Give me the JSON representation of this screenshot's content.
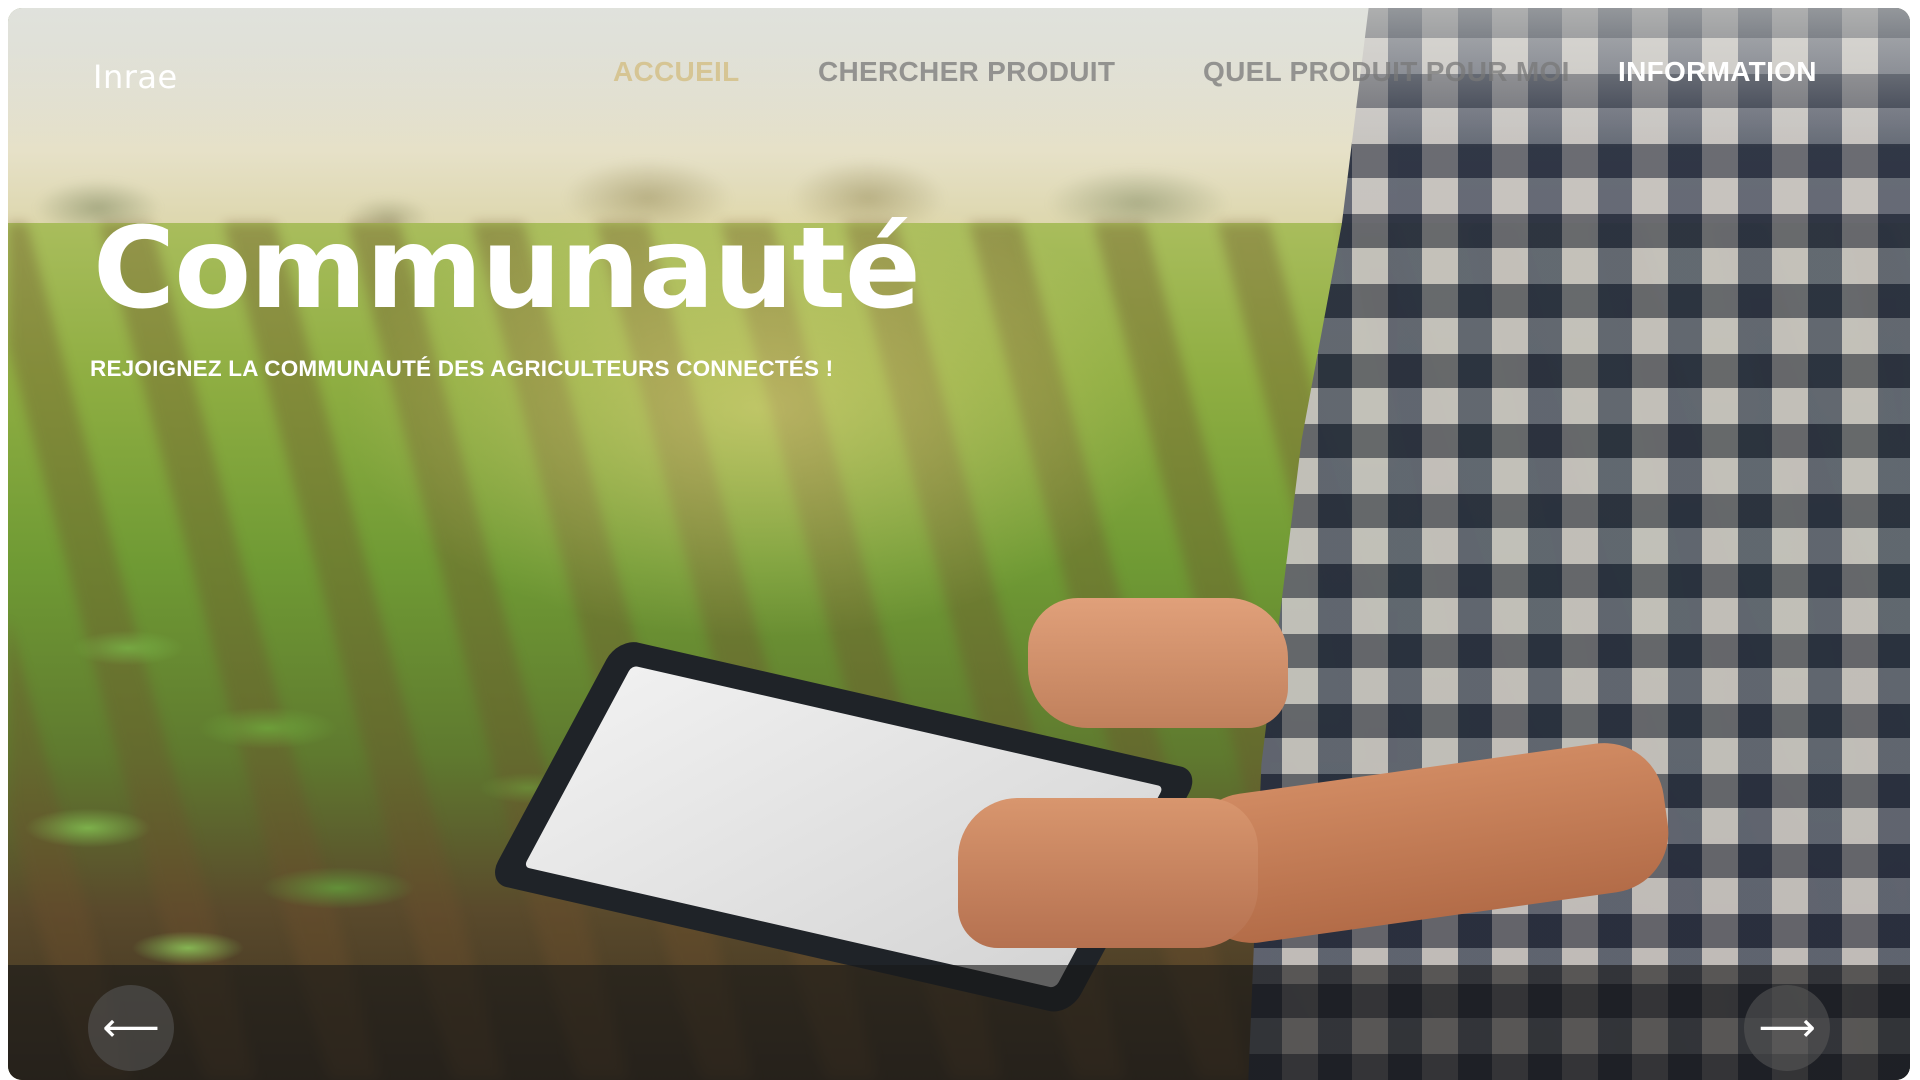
{
  "header": {
    "logo": "Inrae",
    "nav": [
      {
        "label": "ACCUEIL"
      },
      {
        "label": "CHERCHER  PRODUIT"
      },
      {
        "label": "QUEL PRODUIT POUR MOI"
      },
      {
        "label": "INFORMATION"
      }
    ]
  },
  "hero": {
    "title": "Communauté",
    "subtitle": "REJOIGNEZ LA COMMUNAUTÉ DES AGRICULTEURS CONNECTÉS !"
  },
  "carousel": {
    "prev_icon": "arrow-left-icon",
    "prev_glyph": "⟵",
    "next_icon": "arrow-right-icon",
    "next_glyph": "⟶"
  },
  "colors": {
    "nav_active": "#ffffff",
    "nav_faded": "#787878",
    "nav_accueil": "#d2b978",
    "overlay_bar": "#191919"
  }
}
